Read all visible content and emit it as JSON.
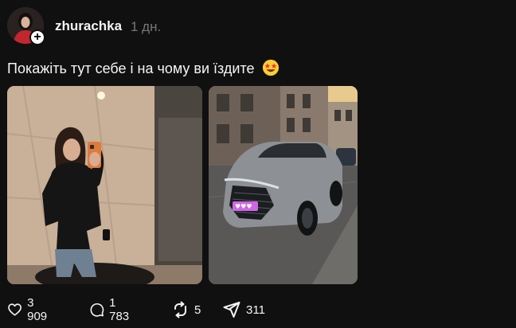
{
  "post": {
    "username": "zhurachka",
    "time": "1 дн.",
    "caption": "Покажіть тут себе і на чому ви їздите",
    "caption_emoji": "star-struck-emoji",
    "follow_icon": "plus-icon"
  },
  "actions": {
    "likes": "3 909",
    "comments": "1 783",
    "reposts": "5",
    "shares": "311"
  },
  "colors": {
    "background": "#101010",
    "text": "#f3f5f7",
    "muted": "#777777"
  }
}
